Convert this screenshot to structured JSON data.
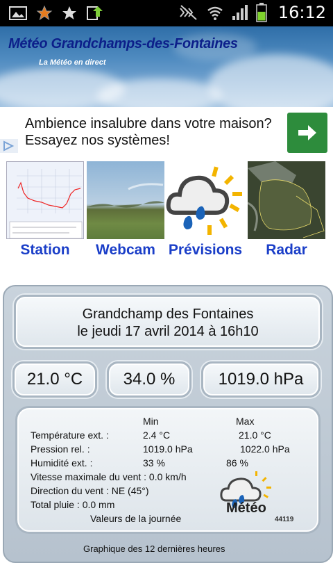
{
  "status_bar": {
    "time": "16:12",
    "left_icons": [
      "gallery-icon",
      "star-outline-icon",
      "star-icon",
      "download-icon"
    ],
    "right_icons": [
      "mute-icon",
      "wifi-icon",
      "signal-icon",
      "battery-icon"
    ],
    "battery_level": 0.6
  },
  "banner": {
    "title": "Météo Grandchamps-des-Fontaines",
    "subtitle": "La Météo en direct"
  },
  "ad": {
    "text": "Ambience insalubre dans votre maison? Essayez nos systèmes!",
    "button_icon": "arrow-right-icon",
    "accent_color": "#2d8c3c"
  },
  "nav": [
    {
      "label": "Station",
      "thumb": "temperature-chart-thumbnail"
    },
    {
      "label": "Webcam",
      "thumb": "webcam-landscape-thumbnail"
    },
    {
      "label": "Prévisions",
      "thumb": "weather-forecast-icon"
    },
    {
      "label": "Radar",
      "thumb": "satellite-map-thumbnail"
    }
  ],
  "station": {
    "location": "Grandchamp des Fontaines",
    "datetime": "le jeudi 17 avril 2014 à 16h10",
    "temperature": "21.0 °C",
    "humidity": "34.0 %",
    "pressure": "1019.0 hPa",
    "min_header": "Min",
    "max_header": "Max",
    "rows": [
      {
        "label": "Température ext. :",
        "min": "2.4 °C",
        "max": "21.0 °C"
      },
      {
        "label": "Pression rel. :",
        "min": "1019.0 hPa",
        "max": "1022.0 hPa"
      },
      {
        "label": "Humidité ext. :",
        "min": "33 %",
        "max": "86 %"
      }
    ],
    "wind_max": "Vitesse maximale du vent : 0.0 km/h",
    "wind_dir": "Direction du vent : NE (45°)",
    "rain": "Total pluie : 0.0 mm",
    "footer": "Valeurs de la journée",
    "logo_text": "Météo",
    "logo_code": "44119",
    "graph_caption": "Graphique des 12 dernières heures"
  }
}
